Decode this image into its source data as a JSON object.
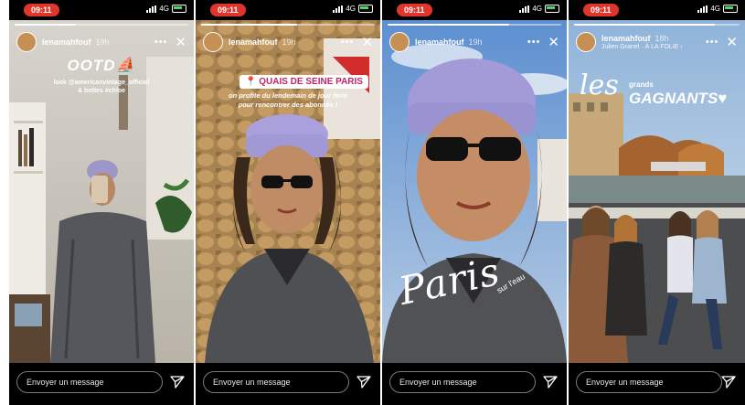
{
  "stories": [
    {
      "status": {
        "time": "09:11",
        "network": "4G"
      },
      "header": {
        "username": "lenamahfouf",
        "time": "19h"
      },
      "overlay": {
        "title": "OOTD⛵",
        "caption": "look @americanvintage_officiel\n& bottes #chloe"
      },
      "message_placeholder": "Envoyer un message",
      "progress": 0.35
    },
    {
      "status": {
        "time": "09:11",
        "network": "4G"
      },
      "header": {
        "username": "lenamahfouf",
        "time": "19h"
      },
      "overlay": {
        "location_tag": "QUAIS DE SEINE PARIS",
        "caption": "on profite du lendemain de jour férié\npour rencontrer des abonnés !"
      },
      "message_placeholder": "Envoyer un message",
      "progress": 0.55
    },
    {
      "status": {
        "time": "09:11",
        "network": "4G"
      },
      "header": {
        "username": "lenamahfouf",
        "time": "19h"
      },
      "overlay": {
        "script": "Paris",
        "sub": "sur l'eau"
      },
      "message_placeholder": "Envoyer un message",
      "progress": 0.7
    },
    {
      "status": {
        "time": "09:11",
        "network": "4G"
      },
      "header": {
        "username": "lenamahfouf",
        "time": "18h",
        "sub": "Julien Granel · À LA FOLIE ›"
      },
      "overlay": {
        "les": "les",
        "grands": "grands",
        "gagnants": "GAGNANTS♥"
      },
      "message_placeholder": "Envoyer un message",
      "progress": 0.85
    }
  ],
  "colors": {
    "time_pill": "#e0352b",
    "location_text": "#c1246b",
    "battery": "#4cd964"
  }
}
